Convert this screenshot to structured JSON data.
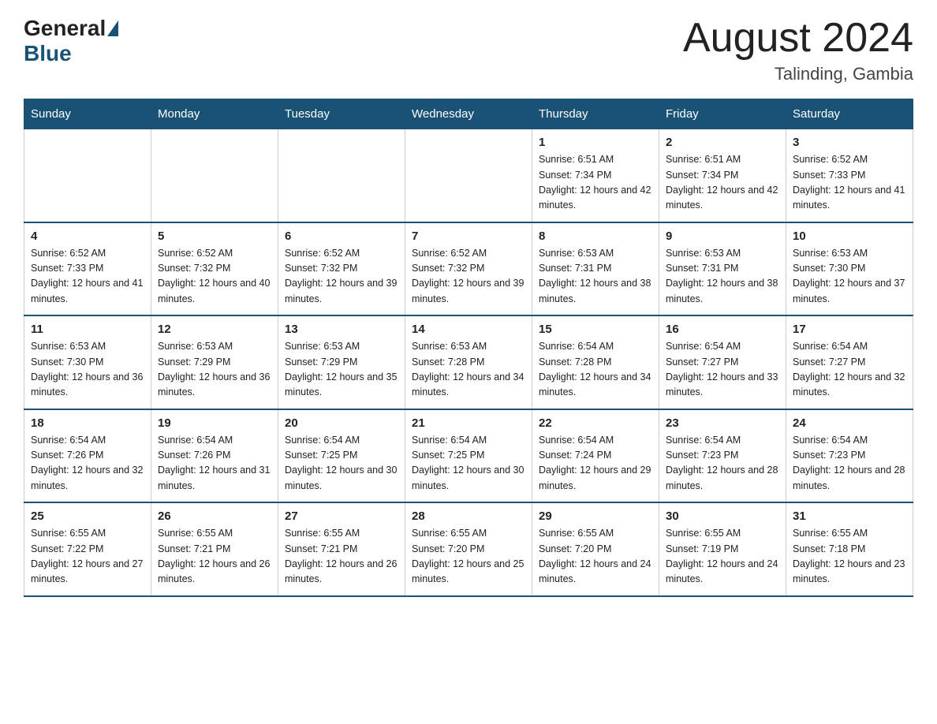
{
  "header": {
    "logo_general": "General",
    "logo_blue": "Blue",
    "month_title": "August 2024",
    "location": "Talinding, Gambia"
  },
  "weekdays": [
    "Sunday",
    "Monday",
    "Tuesday",
    "Wednesday",
    "Thursday",
    "Friday",
    "Saturday"
  ],
  "weeks": [
    [
      {
        "day": "",
        "info": ""
      },
      {
        "day": "",
        "info": ""
      },
      {
        "day": "",
        "info": ""
      },
      {
        "day": "",
        "info": ""
      },
      {
        "day": "1",
        "info": "Sunrise: 6:51 AM\nSunset: 7:34 PM\nDaylight: 12 hours and 42 minutes."
      },
      {
        "day": "2",
        "info": "Sunrise: 6:51 AM\nSunset: 7:34 PM\nDaylight: 12 hours and 42 minutes."
      },
      {
        "day": "3",
        "info": "Sunrise: 6:52 AM\nSunset: 7:33 PM\nDaylight: 12 hours and 41 minutes."
      }
    ],
    [
      {
        "day": "4",
        "info": "Sunrise: 6:52 AM\nSunset: 7:33 PM\nDaylight: 12 hours and 41 minutes."
      },
      {
        "day": "5",
        "info": "Sunrise: 6:52 AM\nSunset: 7:32 PM\nDaylight: 12 hours and 40 minutes."
      },
      {
        "day": "6",
        "info": "Sunrise: 6:52 AM\nSunset: 7:32 PM\nDaylight: 12 hours and 39 minutes."
      },
      {
        "day": "7",
        "info": "Sunrise: 6:52 AM\nSunset: 7:32 PM\nDaylight: 12 hours and 39 minutes."
      },
      {
        "day": "8",
        "info": "Sunrise: 6:53 AM\nSunset: 7:31 PM\nDaylight: 12 hours and 38 minutes."
      },
      {
        "day": "9",
        "info": "Sunrise: 6:53 AM\nSunset: 7:31 PM\nDaylight: 12 hours and 38 minutes."
      },
      {
        "day": "10",
        "info": "Sunrise: 6:53 AM\nSunset: 7:30 PM\nDaylight: 12 hours and 37 minutes."
      }
    ],
    [
      {
        "day": "11",
        "info": "Sunrise: 6:53 AM\nSunset: 7:30 PM\nDaylight: 12 hours and 36 minutes."
      },
      {
        "day": "12",
        "info": "Sunrise: 6:53 AM\nSunset: 7:29 PM\nDaylight: 12 hours and 36 minutes."
      },
      {
        "day": "13",
        "info": "Sunrise: 6:53 AM\nSunset: 7:29 PM\nDaylight: 12 hours and 35 minutes."
      },
      {
        "day": "14",
        "info": "Sunrise: 6:53 AM\nSunset: 7:28 PM\nDaylight: 12 hours and 34 minutes."
      },
      {
        "day": "15",
        "info": "Sunrise: 6:54 AM\nSunset: 7:28 PM\nDaylight: 12 hours and 34 minutes."
      },
      {
        "day": "16",
        "info": "Sunrise: 6:54 AM\nSunset: 7:27 PM\nDaylight: 12 hours and 33 minutes."
      },
      {
        "day": "17",
        "info": "Sunrise: 6:54 AM\nSunset: 7:27 PM\nDaylight: 12 hours and 32 minutes."
      }
    ],
    [
      {
        "day": "18",
        "info": "Sunrise: 6:54 AM\nSunset: 7:26 PM\nDaylight: 12 hours and 32 minutes."
      },
      {
        "day": "19",
        "info": "Sunrise: 6:54 AM\nSunset: 7:26 PM\nDaylight: 12 hours and 31 minutes."
      },
      {
        "day": "20",
        "info": "Sunrise: 6:54 AM\nSunset: 7:25 PM\nDaylight: 12 hours and 30 minutes."
      },
      {
        "day": "21",
        "info": "Sunrise: 6:54 AM\nSunset: 7:25 PM\nDaylight: 12 hours and 30 minutes."
      },
      {
        "day": "22",
        "info": "Sunrise: 6:54 AM\nSunset: 7:24 PM\nDaylight: 12 hours and 29 minutes."
      },
      {
        "day": "23",
        "info": "Sunrise: 6:54 AM\nSunset: 7:23 PM\nDaylight: 12 hours and 28 minutes."
      },
      {
        "day": "24",
        "info": "Sunrise: 6:54 AM\nSunset: 7:23 PM\nDaylight: 12 hours and 28 minutes."
      }
    ],
    [
      {
        "day": "25",
        "info": "Sunrise: 6:55 AM\nSunset: 7:22 PM\nDaylight: 12 hours and 27 minutes."
      },
      {
        "day": "26",
        "info": "Sunrise: 6:55 AM\nSunset: 7:21 PM\nDaylight: 12 hours and 26 minutes."
      },
      {
        "day": "27",
        "info": "Sunrise: 6:55 AM\nSunset: 7:21 PM\nDaylight: 12 hours and 26 minutes."
      },
      {
        "day": "28",
        "info": "Sunrise: 6:55 AM\nSunset: 7:20 PM\nDaylight: 12 hours and 25 minutes."
      },
      {
        "day": "29",
        "info": "Sunrise: 6:55 AM\nSunset: 7:20 PM\nDaylight: 12 hours and 24 minutes."
      },
      {
        "day": "30",
        "info": "Sunrise: 6:55 AM\nSunset: 7:19 PM\nDaylight: 12 hours and 24 minutes."
      },
      {
        "day": "31",
        "info": "Sunrise: 6:55 AM\nSunset: 7:18 PM\nDaylight: 12 hours and 23 minutes."
      }
    ]
  ]
}
